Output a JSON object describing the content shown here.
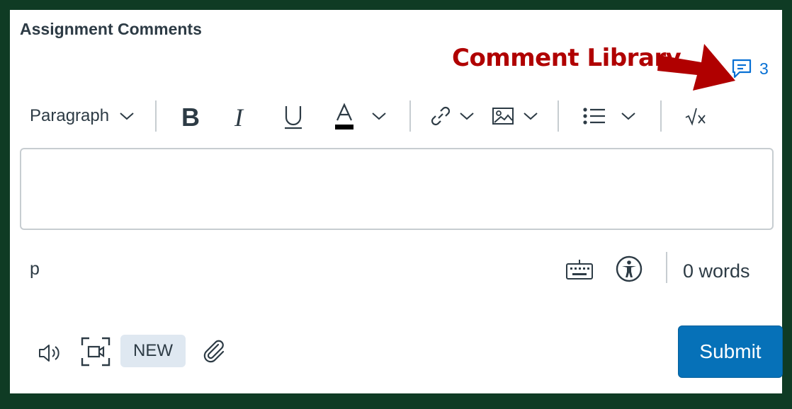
{
  "section": {
    "title": "Assignment Comments"
  },
  "annotation": {
    "text": "Comment Library",
    "color": "#b00000"
  },
  "comment_library": {
    "count": "3",
    "icon": "comment-icon"
  },
  "toolbar": {
    "paragraph_label": "Paragraph",
    "buttons": [
      "bold",
      "italic",
      "underline",
      "text-color",
      "link",
      "image",
      "list",
      "math"
    ]
  },
  "editor": {
    "value": ""
  },
  "statusbar": {
    "path": "p",
    "word_count": "0 words"
  },
  "footer": {
    "new_label": "NEW",
    "submit_label": "Submit"
  },
  "colors": {
    "frame": "#0f3b24",
    "accent": "#0770d4",
    "submit": "#0671b8"
  }
}
